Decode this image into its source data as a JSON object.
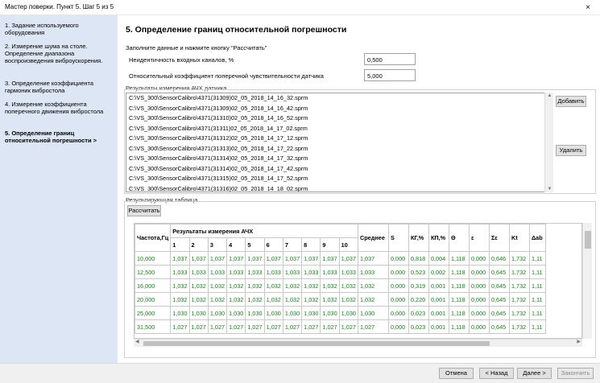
{
  "window": {
    "title": "Мастер поверки. Пункт 5. Шаг 5 из 5",
    "close_icon": "×"
  },
  "sidebar": {
    "steps": [
      "1.  Задание используемого оборудования",
      "2.  Измерение шума на столе. Определение диапазона воспроизведения виброускорения.",
      "3.  Определение коэффициента гармоник вибростола",
      "4.  Измерение коэффициента поперечного движения вибростола",
      "5.  Определение границ относительной погрешности >"
    ]
  },
  "main": {
    "heading": "5.  Определение границ относительной погрешности",
    "instruction": "Заполните данные и нажмите кнопку \"Рассчитать\"",
    "fields": [
      {
        "label": "Неидентичность входных каналов, %",
        "value": "0,500"
      },
      {
        "label": "Относительный коэффициент поперечной чувствительности датчика",
        "value": "5,000"
      }
    ],
    "results_group_label": "Результаты измерения АЧХ датчика",
    "files": [
      "C:\\VS_300\\SensorCalibro\\4371(31309)02_05_2018_14_16_32.sprm",
      "C:\\VS_300\\SensorCalibro\\4371(31309)02_05_2018_14_16_42.sprm",
      "C:\\VS_300\\SensorCalibro\\4371(31310)02_05_2018_14_16_52.sprm",
      "C:\\VS_300\\SensorCalibro\\4371(31311)02_05_2018_14_17_02.sprm",
      "C:\\VS_300\\SensorCalibro\\4371(31312)02_05_2018_14_17_12.sprm",
      "C:\\VS_300\\SensorCalibro\\4371(31313)02_05_2018_14_17_22.sprm",
      "C:\\VS_300\\SensorCalibro\\4371(31314)02_05_2018_14_17_32.sprm",
      "C:\\VS_300\\SensorCalibro\\4371(31314)02_05_2018_14_17_42.sprm",
      "C:\\VS_300\\SensorCalibro\\4371(31315)02_05_2018_14_17_52.sprm",
      "C:\\VS_300\\SensorCalibro\\4371(31316)02_05_2018_14_18_02.sprm"
    ],
    "add_button": "Добавить",
    "remove_button": "Удалить",
    "result_group_label": "Результирующая таблица",
    "calc_button": "Рассчитать",
    "table": {
      "freq_header": "Частота,Гц",
      "results_header": "Результаты измерения АЧХ",
      "sub_headers": [
        "1",
        "2",
        "3",
        "4",
        "5",
        "6",
        "7",
        "8",
        "9",
        "10"
      ],
      "tail_headers": [
        "Среднее",
        "S",
        "КГ,%",
        "КП,%",
        "Θ",
        "ε",
        "Σε",
        "Kt",
        "Δab"
      ],
      "rows": [
        {
          "freq": "10,000",
          "vals": [
            "1,037",
            "1,037",
            "1,037",
            "1,037",
            "1,037",
            "1,037",
            "1,037",
            "1,037",
            "1,037",
            "1,037"
          ],
          "tail": [
            "1,037",
            "0,000",
            "0,818",
            "0,004",
            "1,118",
            "0,000",
            "0,646",
            "1,732",
            "1,11"
          ]
        },
        {
          "freq": "12,500",
          "vals": [
            "1,033",
            "1,033",
            "1,033",
            "1,033",
            "1,033",
            "1,033",
            "1,033",
            "1,033",
            "1,033",
            "1,033"
          ],
          "tail": [
            "1,033",
            "0,000",
            "0,523",
            "0,002",
            "1,118",
            "0,000",
            "0,645",
            "1,732",
            "1,11"
          ]
        },
        {
          "freq": "16,000",
          "vals": [
            "1,032",
            "1,032",
            "1,032",
            "1,032",
            "1,032",
            "1,032",
            "1,032",
            "1,032",
            "1,032",
            "1,032"
          ],
          "tail": [
            "1,032",
            "0,000",
            "0,319",
            "0,001",
            "1,118",
            "0,000",
            "0,645",
            "1,732",
            "1,11"
          ]
        },
        {
          "freq": "20,000",
          "vals": [
            "1,032",
            "1,032",
            "1,032",
            "1,032",
            "1,032",
            "1,032",
            "1,032",
            "1,032",
            "1,032",
            "1,032"
          ],
          "tail": [
            "1,032",
            "0,000",
            "0,220",
            "0,001",
            "1,118",
            "0,000",
            "0,645",
            "1,732",
            "1,11"
          ]
        },
        {
          "freq": "25,000",
          "vals": [
            "1,030",
            "1,030",
            "1,030",
            "1,030",
            "1,030",
            "1,030",
            "1,030",
            "1,030",
            "1,030",
            "1,030"
          ],
          "tail": [
            "1,030",
            "0,000",
            "0,023",
            "0,001",
            "1,118",
            "0,000",
            "0,645",
            "1,732",
            "1,11"
          ]
        },
        {
          "freq": "31,500",
          "vals": [
            "1,027",
            "1,027",
            "1,027",
            "1,027",
            "1,027",
            "1,027",
            "1,027",
            "1,027",
            "1,027",
            "1,027"
          ],
          "tail": [
            "1,027",
            "0,000",
            "0,023",
            "0,001",
            "1,118",
            "0,000",
            "0,645",
            "1,732",
            "1,11"
          ]
        }
      ]
    }
  },
  "footer": {
    "cancel": "Отмена",
    "back": "< Назад",
    "next": "Далее >",
    "finish": "Закончить"
  }
}
